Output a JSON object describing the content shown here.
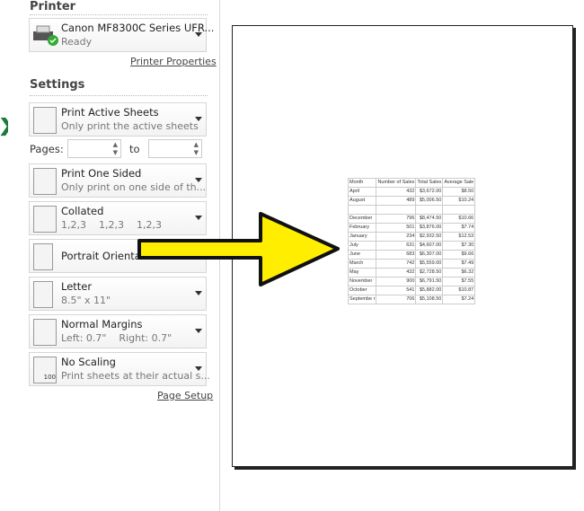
{
  "printer": {
    "section": "Printer",
    "name": "Canon MF8300C Series UFR...",
    "status": "Ready",
    "properties_link": "Printer Properties"
  },
  "settings": {
    "section": "Settings",
    "items": [
      {
        "title": "Print Active Sheets",
        "sub": "Only print the active sheets"
      },
      {
        "title": "Print One Sided",
        "sub": "Only print on one side of th..."
      },
      {
        "title": "Collated",
        "sub": "1,2,3    1,2,3    1,2,3"
      },
      {
        "title": "Portrait Orientation",
        "sub": ""
      },
      {
        "title": "Letter",
        "sub": "8.5\" x 11\""
      },
      {
        "title": "Normal Margins",
        "sub": "Left: 0.7\"    Right: 0.7\""
      },
      {
        "title": "No Scaling",
        "sub": "Print sheets at their actual s..."
      }
    ],
    "pages_label": "Pages:",
    "to_label": "to",
    "pages_from": "",
    "pages_to": "",
    "page_setup_link": "Page Setup"
  },
  "preview": {
    "headers": [
      "Month",
      "Number of Sales",
      "Total Sales",
      "Average Sale"
    ],
    "rows": [
      [
        "April",
        "432",
        "$3,672.00",
        "$8.50"
      ],
      [
        "August",
        "489",
        "$5,006.50",
        "$10.24"
      ],
      [
        "",
        "",
        "",
        ""
      ],
      [
        "December",
        "796",
        "$8,474.50",
        "$10.66"
      ],
      [
        "February",
        "501",
        "$3,876.00",
        "$7.74"
      ],
      [
        "January",
        "234",
        "$2,932.50",
        "$12.53"
      ],
      [
        "July",
        "631",
        "$4,607.00",
        "$7.30"
      ],
      [
        "June",
        "683",
        "$6,307.00",
        "$9.66"
      ],
      [
        "March",
        "742",
        "$5,559.00",
        "$7.49"
      ],
      [
        "May",
        "432",
        "$2,728.50",
        "$6.32"
      ],
      [
        "November",
        "900",
        "$6,791.50",
        "$7.55"
      ],
      [
        "October",
        "541",
        "$5,882.00",
        "$10.87"
      ],
      [
        "Septembe r",
        "706",
        "$5,108.50",
        "$7.24"
      ]
    ]
  },
  "colors": {
    "arrow": "#ffee00",
    "excel_green": "#1e7a3c"
  }
}
